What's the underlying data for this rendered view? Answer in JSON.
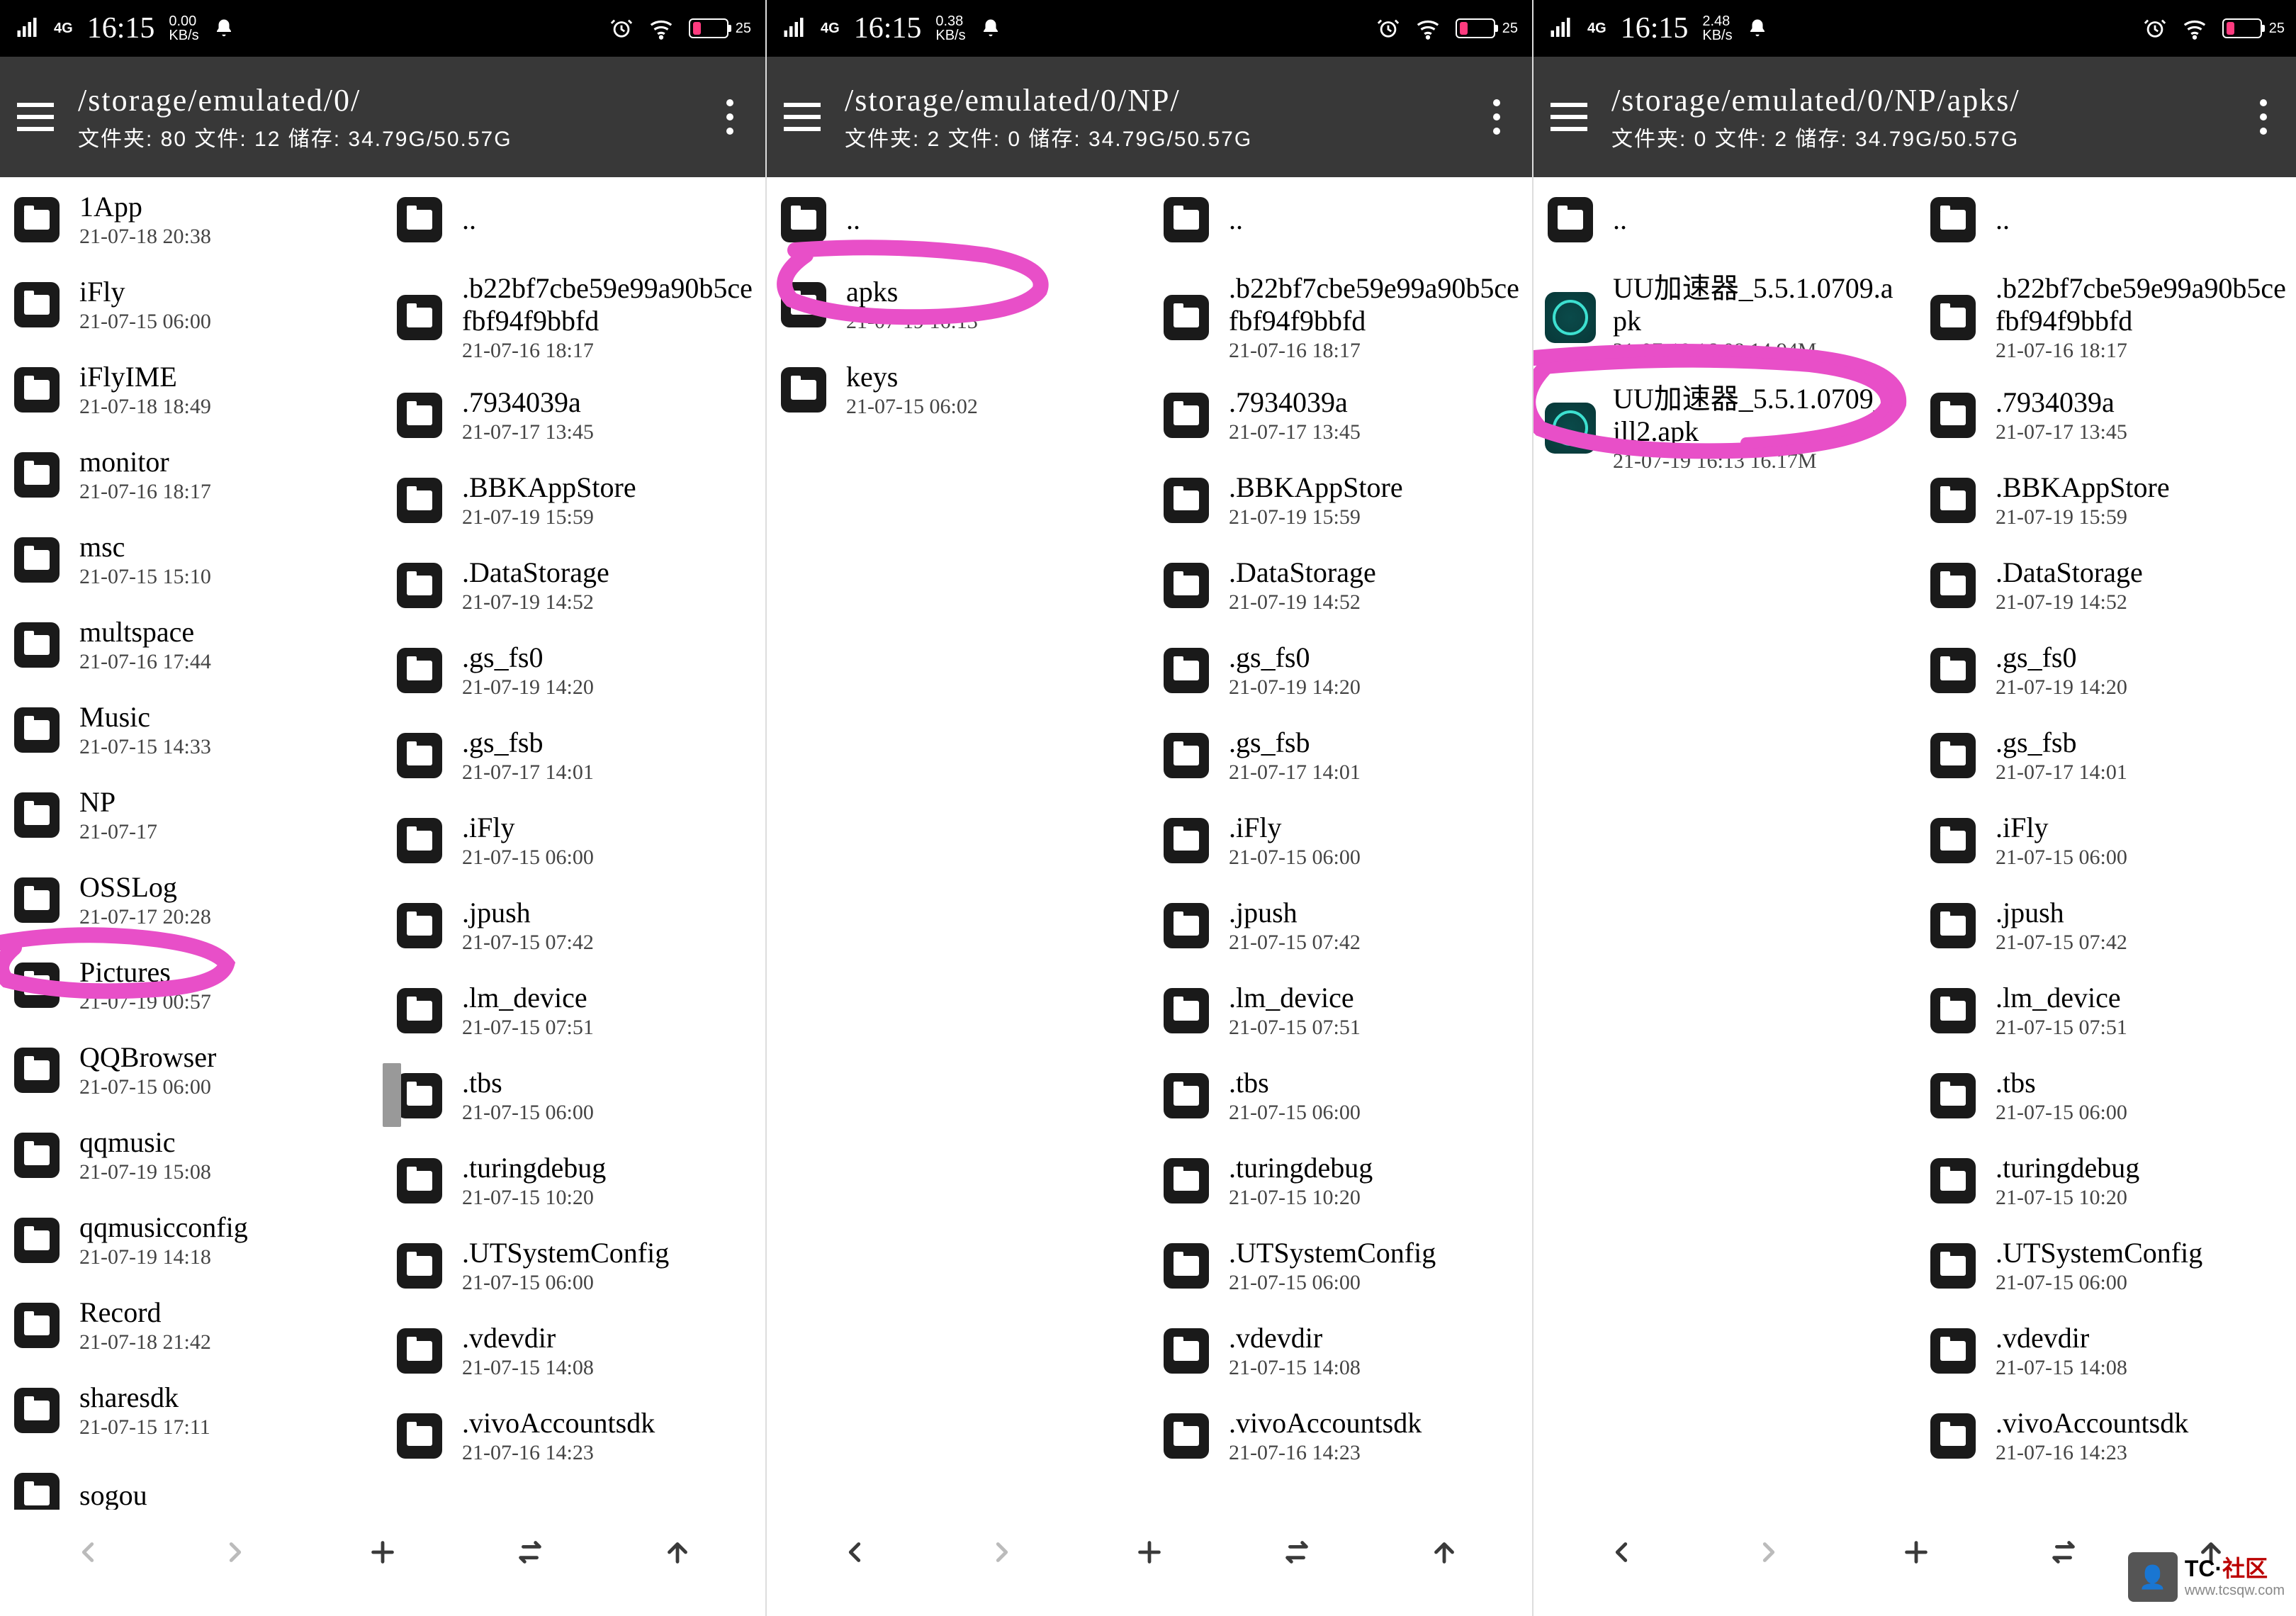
{
  "status": {
    "net": "4G",
    "time": "16:15",
    "speed1": "0.00",
    "speed2": "0.38",
    "speed3": "2.48",
    "speed_unit": "KB/s",
    "alarm": "⏰",
    "wifi": "📶",
    "bat_pct": "25"
  },
  "headers": [
    {
      "path": "/storage/emulated/0/",
      "sub": "文件夹: 80  文件: 12  储存: 34.79G/50.57G"
    },
    {
      "path": "/storage/emulated/0/NP/",
      "sub": "文件夹: 2  文件: 0  储存: 34.79G/50.57G"
    },
    {
      "path": "/storage/emulated/0/NP/apks/",
      "sub": "文件夹: 0  文件: 2  储存: 34.79G/50.57G"
    }
  ],
  "col_a_left": [
    {
      "name": "1App",
      "date": "21-07-18 20:38"
    },
    {
      "name": "iFly",
      "date": "21-07-15 06:00"
    },
    {
      "name": "iFlyIME",
      "date": "21-07-18 18:49"
    },
    {
      "name": "monitor",
      "date": "21-07-16 18:17"
    },
    {
      "name": "msc",
      "date": "21-07-15 15:10"
    },
    {
      "name": "multspace",
      "date": "21-07-16 17:44"
    },
    {
      "name": "Music",
      "date": "21-07-15 14:33"
    },
    {
      "name": "NP",
      "date": "21-07-17"
    },
    {
      "name": "OSSLog",
      "date": "21-07-17 20:28"
    },
    {
      "name": "Pictures",
      "date": "21-07-19 00:57"
    },
    {
      "name": "QQBrowser",
      "date": "21-07-15 06:00"
    },
    {
      "name": "qqmusic",
      "date": "21-07-19 15:08"
    },
    {
      "name": "qqmusicconfig",
      "date": "21-07-19 14:18"
    },
    {
      "name": "Record",
      "date": "21-07-18 21:42"
    },
    {
      "name": "sharesdk",
      "date": "21-07-15 17:11"
    },
    {
      "name": "sogou",
      "date": ""
    }
  ],
  "folder_col": [
    {
      "name": "..",
      "date": ""
    },
    {
      "name": ".b22bf7cbe59e99a90b5cefbf94f9bbfd",
      "date": "21-07-16 18:17"
    },
    {
      "name": ".7934039a",
      "date": "21-07-17 13:45"
    },
    {
      "name": ".BBKAppStore",
      "date": "21-07-19 15:59"
    },
    {
      "name": ".DataStorage",
      "date": "21-07-19 14:52"
    },
    {
      "name": ".gs_fs0",
      "date": "21-07-19 14:20"
    },
    {
      "name": ".gs_fsb",
      "date": "21-07-17 14:01"
    },
    {
      "name": ".iFly",
      "date": "21-07-15 06:00"
    },
    {
      "name": ".jpush",
      "date": "21-07-15 07:42"
    },
    {
      "name": ".lm_device",
      "date": "21-07-15 07:51"
    },
    {
      "name": ".tbs",
      "date": "21-07-15 06:00"
    },
    {
      "name": ".turingdebug",
      "date": "21-07-15 10:20"
    },
    {
      "name": ".UTSystemConfig",
      "date": "21-07-15 06:00"
    },
    {
      "name": ".vdevdir",
      "date": "21-07-15 14:08"
    },
    {
      "name": ".vivoAccountsdk",
      "date": "21-07-16 14:23"
    }
  ],
  "np_col": [
    {
      "name": "..",
      "date": ""
    },
    {
      "name": "apks",
      "date": "21-07-19 16:13"
    },
    {
      "name": "keys",
      "date": "21-07-15 06:02"
    }
  ],
  "apks_col": [
    {
      "name": "..",
      "date": ""
    },
    {
      "name": "UU加速器_5.5.1.0709.apk",
      "date": "21-07-19 16:08  14.94M",
      "apk": true
    },
    {
      "name": "UU加速器_5.5.1.0709_kill2.apk",
      "date": "21-07-19 16:13  16.17M",
      "apk": true
    }
  ],
  "watermark": {
    "line1_a": "TC·",
    "line1_b": "社区",
    "line2": "www.tcsqw.com"
  }
}
